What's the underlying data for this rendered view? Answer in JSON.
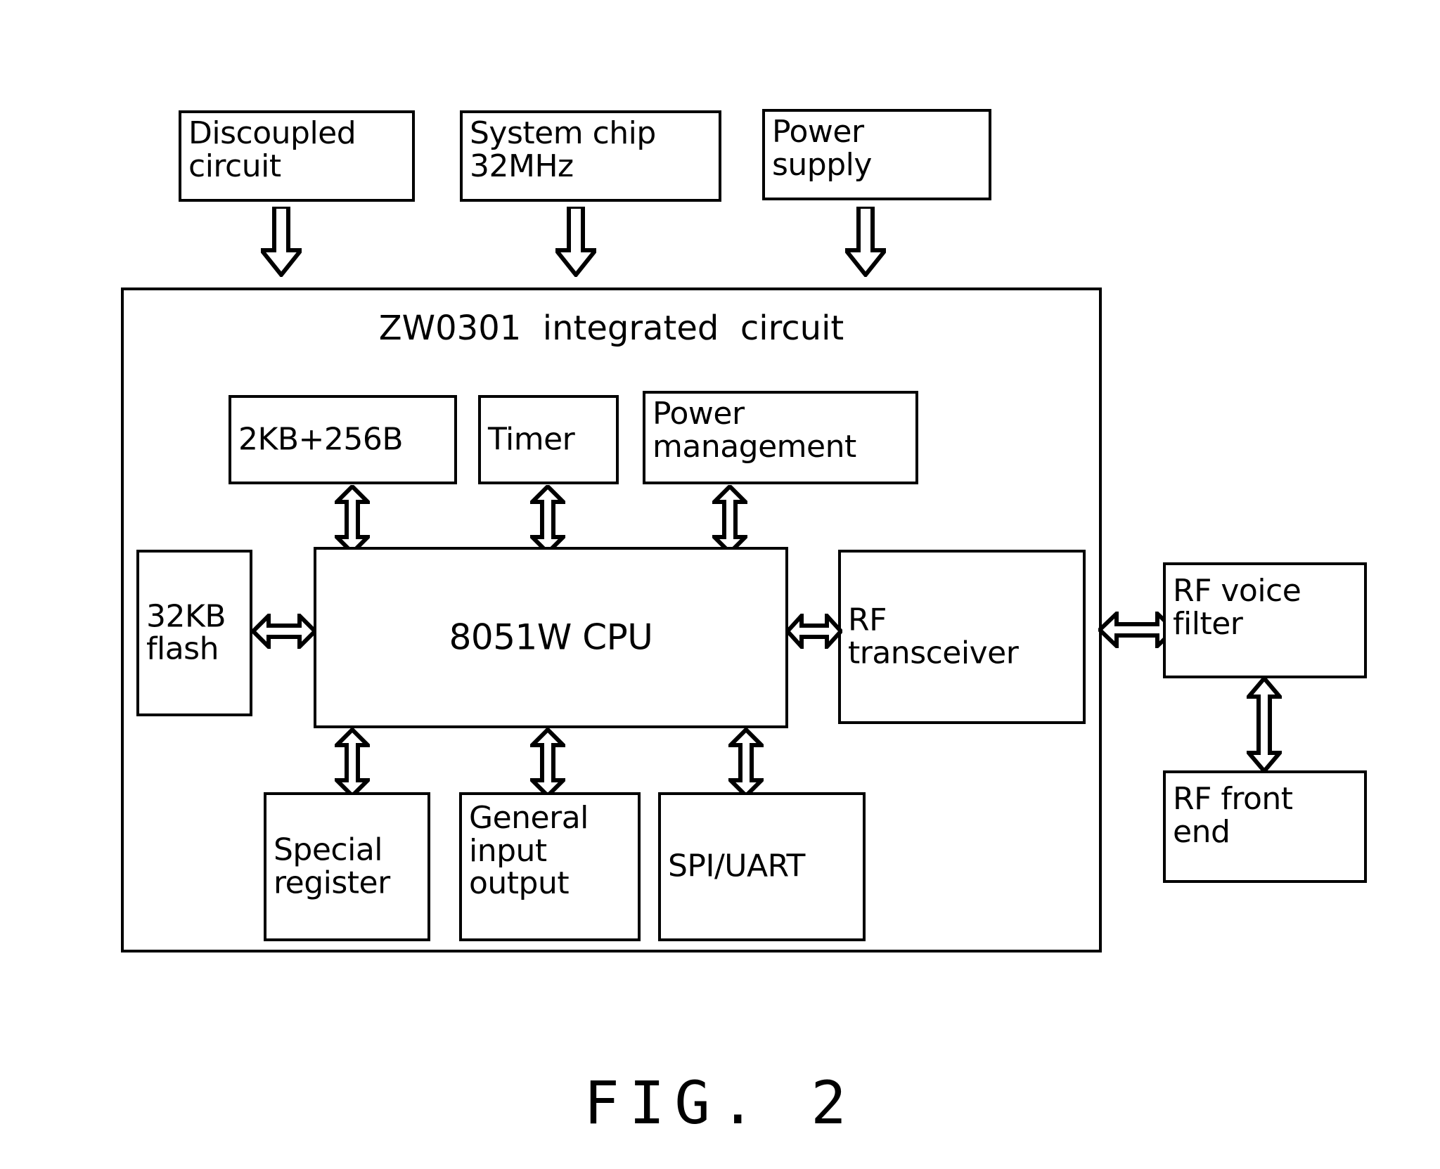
{
  "figure": {
    "caption": "FIG. 2",
    "title": "ZW0301  integrated  circuit"
  },
  "external_blocks": [
    {
      "id": "discoupled-circuit",
      "label": "Discoupled\ncircuit"
    },
    {
      "id": "system-chip",
      "label": "System  chip\n32MHz"
    },
    {
      "id": "power-supply",
      "label": "Power\nsupply"
    },
    {
      "id": "rf-voice-filter",
      "label": "RF  voice\nfilter"
    },
    {
      "id": "rf-front-end",
      "label": "RF  front\nend"
    }
  ],
  "internal_blocks": [
    {
      "id": "ram",
      "label": "2KB+256B"
    },
    {
      "id": "timer",
      "label": "Timer"
    },
    {
      "id": "power-management",
      "label": "Power\nmanagement"
    },
    {
      "id": "flash",
      "label": "32KB\nflash"
    },
    {
      "id": "cpu",
      "label": "8051W   CPU"
    },
    {
      "id": "rf-transceiver",
      "label": "RF\ntransceiver"
    },
    {
      "id": "special-register",
      "label": "Special\nregister"
    },
    {
      "id": "general-io",
      "label": "General\ninput\noutput"
    },
    {
      "id": "spi-uart",
      "label": "SPI/UART"
    }
  ],
  "connections": [
    {
      "id": "discoupled-to-chip",
      "direction": "down",
      "from": "discoupled-circuit",
      "to": "zw0301-integrated-circuit"
    },
    {
      "id": "system-chip-to-chip",
      "direction": "down",
      "from": "system-chip",
      "to": "zw0301-integrated-circuit"
    },
    {
      "id": "power-supply-to-chip",
      "direction": "down",
      "from": "power-supply",
      "to": "zw0301-integrated-circuit"
    },
    {
      "id": "ram-to-cpu",
      "direction": "vertical",
      "from": "ram",
      "to": "cpu"
    },
    {
      "id": "timer-to-cpu",
      "direction": "vertical",
      "from": "timer",
      "to": "cpu"
    },
    {
      "id": "power-mgmt-to-cpu",
      "direction": "vertical",
      "from": "power-management",
      "to": "cpu"
    },
    {
      "id": "flash-to-cpu",
      "direction": "horizontal",
      "from": "flash",
      "to": "cpu"
    },
    {
      "id": "cpu-to-rf-transceiver",
      "direction": "horizontal",
      "from": "cpu",
      "to": "rf-transceiver"
    },
    {
      "id": "cpu-to-special-register",
      "direction": "vertical",
      "from": "cpu",
      "to": "special-register"
    },
    {
      "id": "cpu-to-general-io",
      "direction": "vertical",
      "from": "cpu",
      "to": "general-io"
    },
    {
      "id": "cpu-to-spi-uart",
      "direction": "vertical",
      "from": "cpu",
      "to": "spi-uart"
    },
    {
      "id": "transceiver-to-filter",
      "direction": "horizontal",
      "from": "rf-transceiver",
      "to": "rf-voice-filter"
    },
    {
      "id": "filter-to-front-end",
      "direction": "vertical",
      "from": "rf-voice-filter",
      "to": "rf-front-end"
    }
  ],
  "colors": {
    "stroke": "#000000",
    "fill": "#ffffff",
    "background": "#ffffff"
  }
}
